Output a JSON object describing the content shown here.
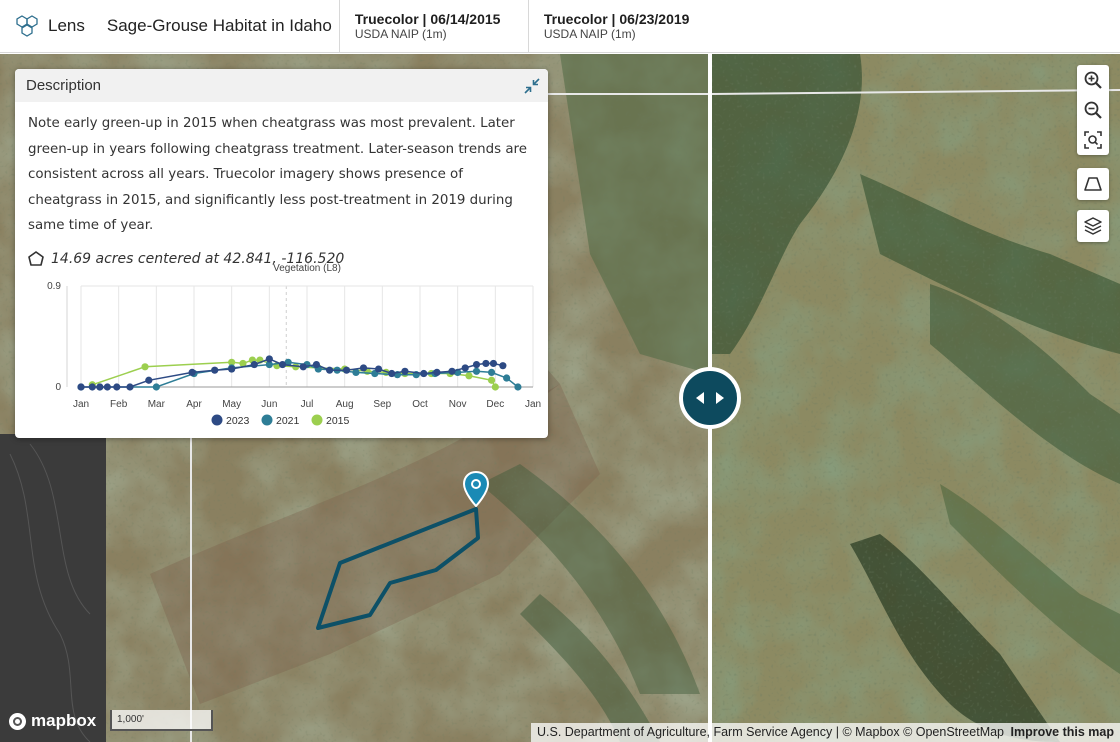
{
  "header": {
    "brand_name": "Lens",
    "project_title": "Sage-Grouse Habitat in Idaho",
    "layers": [
      {
        "title": "Truecolor | 06/14/2015",
        "subtitle": "USDA NAIP (1m)"
      },
      {
        "title": "Truecolor | 06/23/2019",
        "subtitle": "USDA NAIP (1m)"
      }
    ]
  },
  "panel": {
    "title": "Description",
    "description": "Note early green-up in 2015 when cheatgrass was most prevalent. Later green-up in years following cheatgrass treatment. Later-season trends are consistent across all years. Truecolor imagery shows presence of cheatgrass in 2015, and significantly less post-treatment in 2019 during same time of year.",
    "area": "14.69 acres centered at 42.841, -116.520"
  },
  "chart_data": {
    "type": "line",
    "title": "Vegetation (L8)",
    "xlabel": "",
    "ylabel": "",
    "ylim": [
      0,
      0.9
    ],
    "yticks": [
      0,
      0.9
    ],
    "categories": [
      "Jan",
      "Feb",
      "Mar",
      "Apr",
      "May",
      "Jun",
      "Jul",
      "Aug",
      "Sep",
      "Oct",
      "Nov",
      "Dec",
      "Jan"
    ],
    "x_unit": "month index (0 = Jan)",
    "legend_position": "bottom",
    "grid": true,
    "series": [
      {
        "name": "2023",
        "color": "#2d4a84",
        "points": [
          [
            0.0,
            0.0
          ],
          [
            0.3,
            0.0
          ],
          [
            0.5,
            0.0
          ],
          [
            0.7,
            0.0
          ],
          [
            0.95,
            0.0
          ],
          [
            1.3,
            0.0
          ],
          [
            1.8,
            0.06
          ],
          [
            2.95,
            0.13
          ],
          [
            3.55,
            0.15
          ],
          [
            4.0,
            0.16
          ],
          [
            4.6,
            0.2
          ],
          [
            5.0,
            0.25
          ],
          [
            5.35,
            0.2
          ],
          [
            5.9,
            0.18
          ],
          [
            6.25,
            0.2
          ],
          [
            6.6,
            0.15
          ],
          [
            7.05,
            0.15
          ],
          [
            7.5,
            0.17
          ],
          [
            7.9,
            0.16
          ],
          [
            8.25,
            0.12
          ],
          [
            8.6,
            0.14
          ],
          [
            9.1,
            0.12
          ],
          [
            9.45,
            0.13
          ],
          [
            9.85,
            0.14
          ],
          [
            10.2,
            0.17
          ],
          [
            10.5,
            0.2
          ],
          [
            10.75,
            0.21
          ],
          [
            10.95,
            0.21
          ],
          [
            11.2,
            0.19
          ]
        ]
      },
      {
        "name": "2021",
        "color": "#2e7d96",
        "points": [
          [
            0.0,
            0.0
          ],
          [
            0.5,
            0.0
          ],
          [
            2.0,
            0.0
          ],
          [
            3.0,
            0.12
          ],
          [
            4.0,
            0.17
          ],
          [
            5.0,
            0.2
          ],
          [
            5.5,
            0.22
          ],
          [
            6.0,
            0.2
          ],
          [
            6.3,
            0.16
          ],
          [
            6.8,
            0.15
          ],
          [
            7.3,
            0.13
          ],
          [
            7.8,
            0.12
          ],
          [
            8.4,
            0.11
          ],
          [
            8.9,
            0.11
          ],
          [
            9.4,
            0.12
          ],
          [
            10.0,
            0.13
          ],
          [
            10.5,
            0.14
          ],
          [
            10.9,
            0.13
          ],
          [
            11.3,
            0.08
          ],
          [
            11.6,
            0.0
          ]
        ]
      },
      {
        "name": "2015",
        "color": "#9ccf4f",
        "points": [
          [
            0.3,
            0.02
          ],
          [
            1.7,
            0.18
          ],
          [
            4.0,
            0.22
          ],
          [
            4.3,
            0.21
          ],
          [
            4.55,
            0.24
          ],
          [
            4.75,
            0.24
          ],
          [
            5.2,
            0.19
          ],
          [
            5.7,
            0.18
          ],
          [
            6.3,
            0.17
          ],
          [
            7.0,
            0.16
          ],
          [
            7.6,
            0.14
          ],
          [
            8.1,
            0.13
          ],
          [
            8.6,
            0.12
          ],
          [
            9.3,
            0.12
          ],
          [
            9.8,
            0.12
          ],
          [
            10.3,
            0.1
          ],
          [
            10.9,
            0.06
          ],
          [
            11.0,
            0.0
          ]
        ]
      }
    ]
  },
  "toolbar": {
    "tools": [
      {
        "name": "zoom-in-icon"
      },
      {
        "name": "zoom-out-icon"
      },
      {
        "name": "zoom-extent-icon"
      },
      {
        "name": "perspective-icon"
      },
      {
        "name": "layers-icon"
      }
    ]
  },
  "footer": {
    "mapbox_label": "mapbox",
    "scale_label": "1,000'",
    "attribution": "U.S. Department of Agriculture, Farm Service Agency | © Mapbox © OpenStreetMap",
    "improve_label": "Improve this map"
  }
}
